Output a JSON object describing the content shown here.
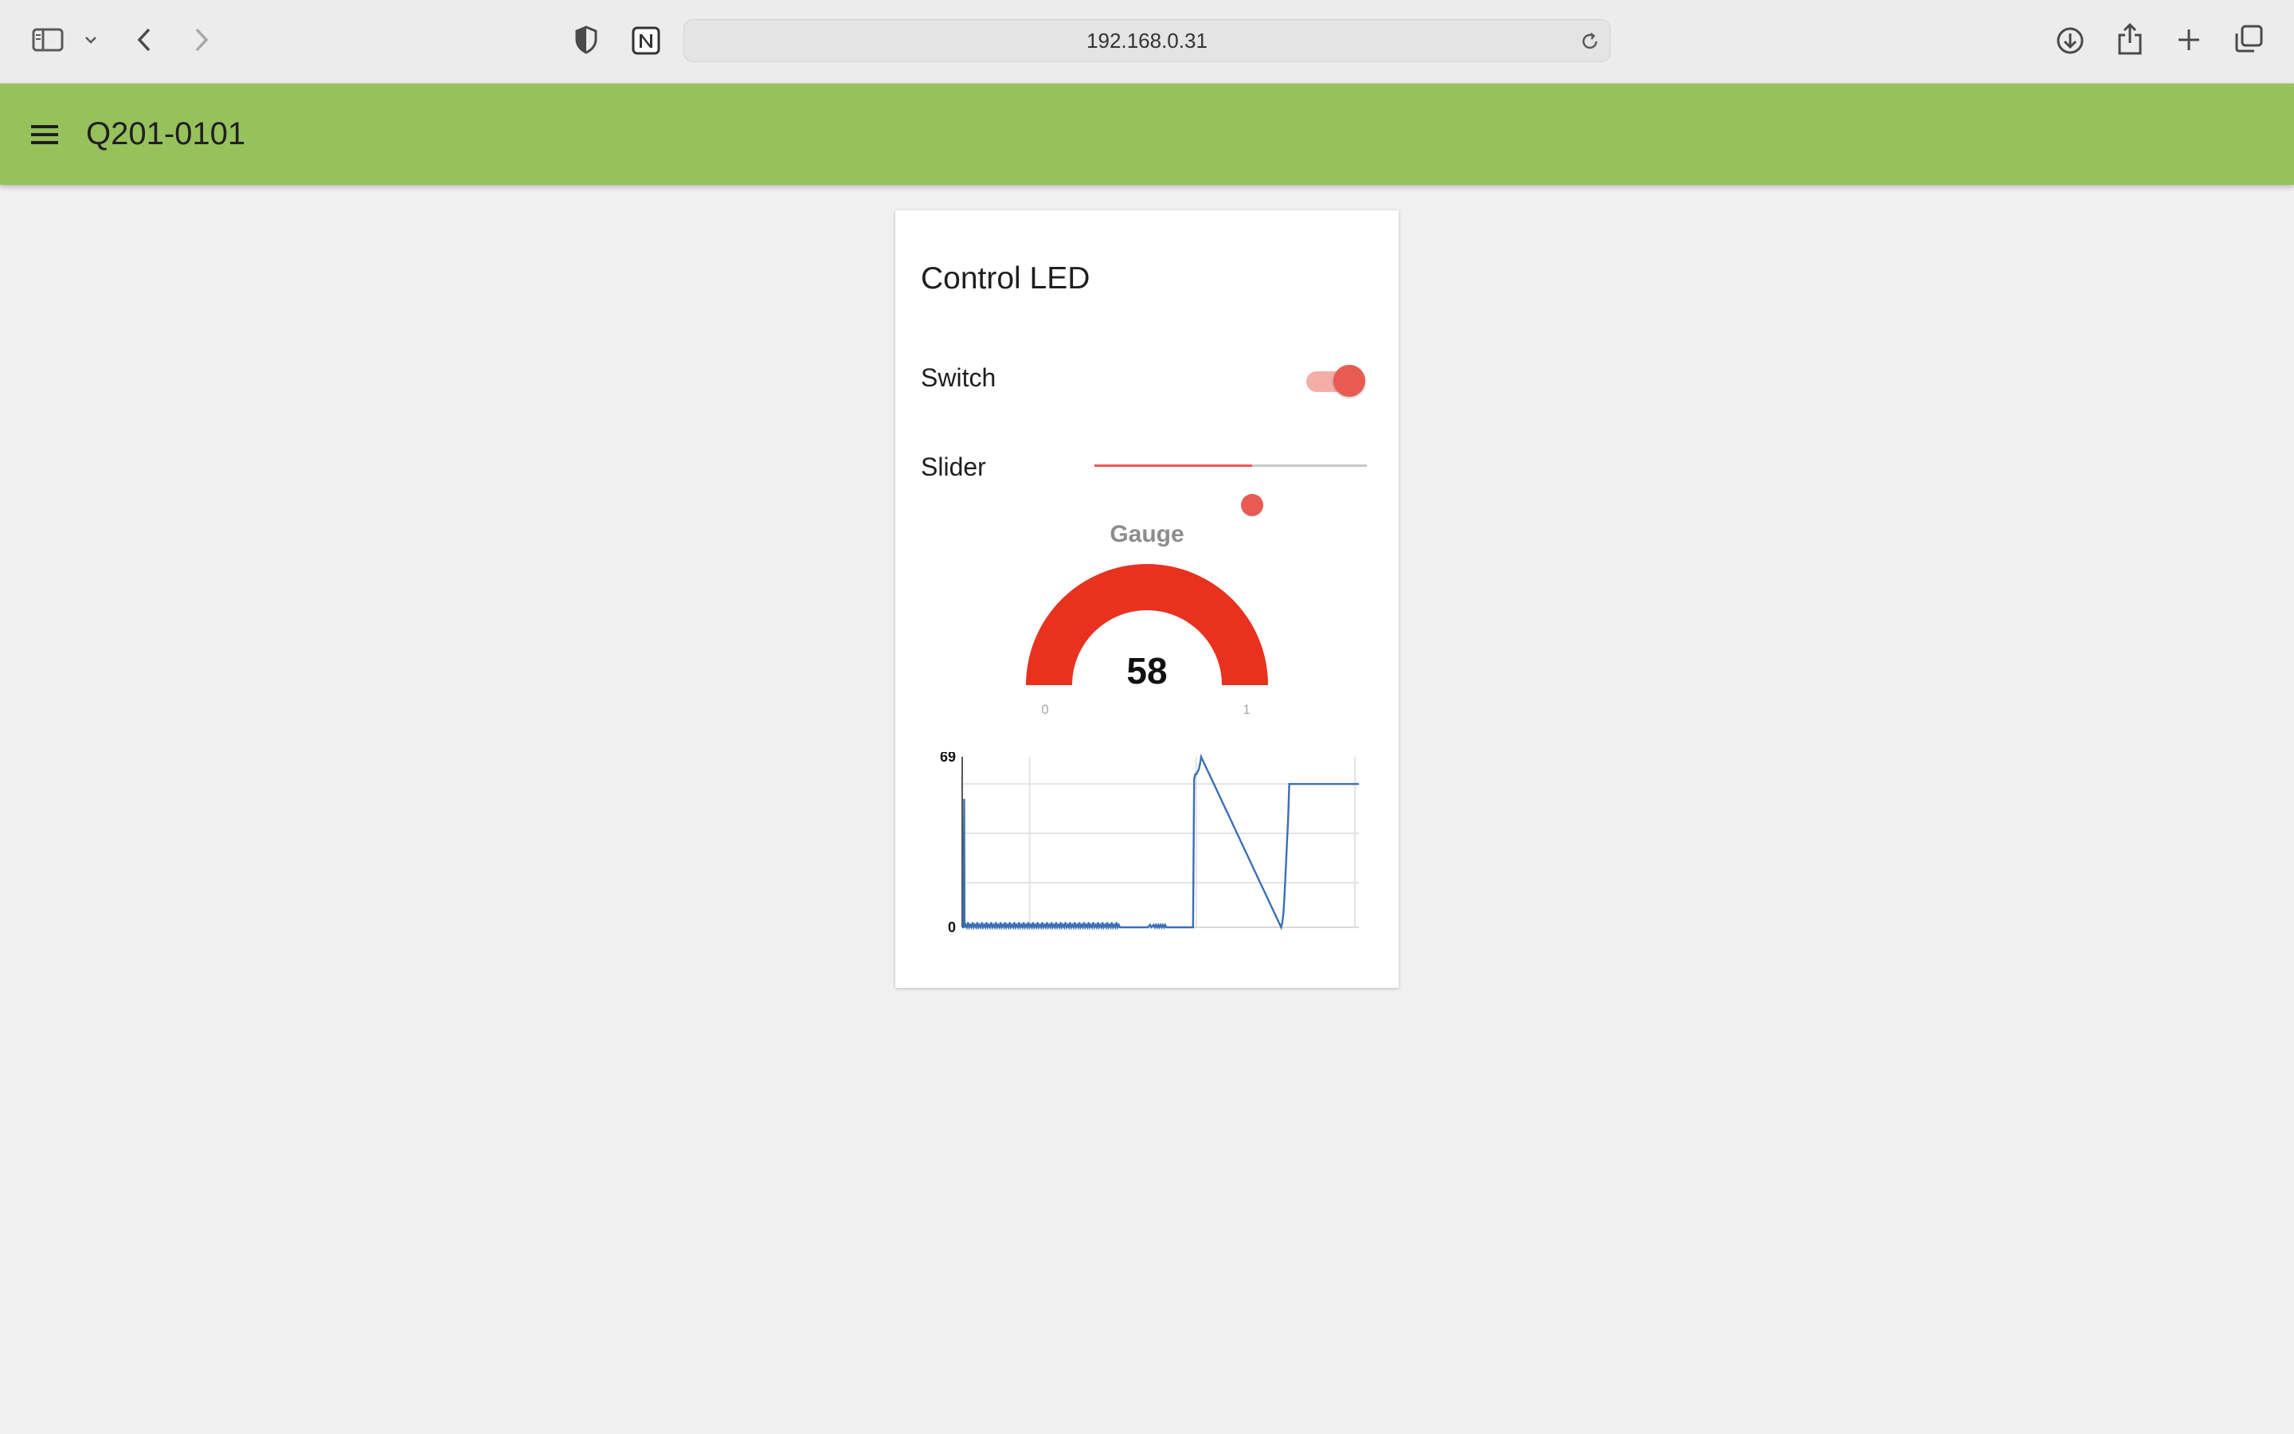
{
  "browser": {
    "url": "192.168.0.31"
  },
  "app": {
    "title": "Q201-0101"
  },
  "card": {
    "title": "Control LED",
    "switch": {
      "label": "Switch",
      "on": true
    },
    "slider": {
      "label": "Slider",
      "value_fraction": 0.58
    },
    "gauge": {
      "label": "Gauge",
      "value": "58",
      "min_label": "0",
      "max_label": "1",
      "color": "#e8321f",
      "fill_fraction": 1.0
    }
  },
  "colors": {
    "header": "#97c15b",
    "accent": "#e85b52",
    "gauge": "#e8321f",
    "chart_line": "#3a6fb5"
  },
  "chart_data": {
    "type": "line",
    "title": "",
    "xlabel": "",
    "ylabel": "",
    "ylim": [
      0,
      69
    ],
    "y_tick_labels": [
      "69",
      "0"
    ],
    "grid": true,
    "series": [
      {
        "x": [
          0,
          2,
          3.4,
          4,
          6,
          8,
          10,
          12,
          14,
          16,
          18,
          20,
          22,
          24,
          26,
          28,
          30,
          32,
          34,
          36,
          38,
          40,
          42,
          44,
          46,
          48,
          50,
          52,
          54,
          56,
          58,
          60,
          62,
          64,
          66,
          68,
          70,
          72,
          74,
          76,
          78,
          80,
          82,
          84,
          86,
          88,
          90,
          92,
          94,
          96,
          98,
          100,
          102,
          104,
          106,
          108,
          110,
          112,
          114,
          116,
          118,
          120,
          122,
          124,
          126,
          128,
          130,
          132,
          134,
          136,
          138,
          140,
          142,
          144,
          146,
          148,
          150,
          152,
          154,
          156,
          158,
          160,
          162,
          164,
          166,
          168,
          170,
          172,
          174,
          176,
          178,
          180,
          182,
          184,
          186,
          188,
          190,
          192,
          194,
          196,
          198,
          200,
          202,
          204,
          206,
          208,
          210,
          212,
          214,
          216,
          218,
          220,
          222,
          224,
          226,
          228,
          230,
          232,
          234,
          236,
          238,
          240,
          242,
          244,
          246,
          248,
          250,
          252,
          254,
          256,
          258,
          260,
          262,
          264,
          266,
          268,
          270,
          272
        ],
        "y": [
          0,
          0,
          52,
          0,
          1,
          0,
          2,
          0,
          1,
          0,
          2,
          0,
          1,
          0,
          2,
          0,
          1,
          0,
          2,
          0,
          1,
          0,
          2,
          0,
          1,
          0,
          2,
          0,
          1,
          0,
          2,
          0,
          1,
          0,
          2,
          0,
          1,
          0,
          2,
          0,
          1,
          0,
          2,
          0,
          1,
          0,
          2,
          0,
          1,
          0,
          2,
          0,
          1,
          0,
          2,
          0,
          1,
          0,
          2,
          0,
          1,
          0,
          2,
          0,
          1,
          0,
          2,
          0,
          1,
          0,
          2,
          0,
          1,
          0,
          2,
          0,
          1,
          0,
          2,
          0,
          1,
          0,
          2,
          0,
          1,
          0,
          2,
          0,
          1,
          0,
          2,
          0,
          1,
          0,
          2,
          0,
          1,
          0,
          2,
          0,
          1,
          0,
          2,
          0,
          1,
          0,
          2,
          0,
          1,
          0,
          2,
          0,
          1,
          0,
          2,
          0,
          1,
          0,
          2,
          0,
          1,
          0,
          2,
          0,
          1,
          0,
          2,
          0,
          1,
          0,
          2,
          0,
          1,
          0,
          2,
          0,
          1,
          0
        ]
      }
    ],
    "series_tail": {
      "x": [
        272,
        276,
        280,
        284,
        288,
        292,
        296,
        300,
        304,
        308,
        312,
        316,
        320,
        324,
        326,
        330,
        332,
        334,
        336,
        338,
        340,
        342,
        344,
        346,
        348,
        350,
        352,
        356,
        358,
        362,
        366,
        372,
        376,
        378,
        380,
        382,
        386,
        390,
        394,
        398,
        400,
        402,
        404,
        406,
        408,
        410,
        412,
        414,
        418,
        422,
        426,
        430,
        434,
        438,
        442,
        446,
        450,
        454,
        458,
        462,
        466,
        470,
        474,
        478,
        482,
        486,
        490,
        494,
        498,
        502,
        506,
        510,
        514,
        518,
        522,
        524,
        526,
        528,
        530,
        532,
        534,
        536,
        538,
        540,
        542,
        544,
        546,
        548,
        550,
        552,
        554,
        556,
        558,
        560,
        562,
        564,
        566,
        568,
        570,
        572,
        574,
        576,
        578,
        580,
        582,
        584,
        586,
        588,
        590,
        592,
        594,
        596,
        598,
        600,
        602,
        604,
        606,
        608,
        610,
        612,
        614,
        616,
        618,
        620,
        622,
        624,
        626,
        628,
        630,
        632,
        634,
        636,
        638,
        640,
        642,
        644,
        646,
        648,
        650,
        652,
        654,
        656,
        658,
        660,
        662,
        664,
        666,
        668,
        670,
        672,
        674,
        676,
        678,
        680,
        682,
        684
      ],
      "y": [
        0,
        0,
        0,
        0,
        0,
        0,
        0,
        0,
        0,
        0,
        0,
        0,
        0,
        1,
        0,
        1,
        0,
        1,
        0,
        1,
        0,
        1,
        0,
        1,
        0,
        1,
        0,
        0,
        0,
        0,
        0,
        0,
        0,
        0,
        0,
        0,
        0,
        0,
        0,
        0,
        60,
        62,
        62,
        63,
        64,
        66,
        69,
        68,
        66,
        64,
        62,
        60,
        58,
        56,
        54,
        52,
        50,
        48,
        46,
        44,
        42,
        40,
        38,
        36,
        34,
        32,
        30,
        28,
        26,
        24,
        22,
        20,
        18,
        16,
        14,
        13,
        12,
        11,
        10,
        9,
        8,
        7,
        6,
        5,
        4,
        3,
        2,
        1,
        0,
        2,
        6,
        14,
        24,
        34,
        44,
        58,
        58,
        58,
        58,
        58,
        58,
        58,
        58,
        58,
        58,
        58,
        58,
        58,
        58,
        58,
        58,
        58,
        58,
        58,
        58,
        58,
        58,
        58,
        58,
        58,
        58,
        58,
        58,
        58,
        58,
        58,
        58,
        58,
        58,
        58,
        58,
        58,
        58,
        58,
        58,
        58,
        58,
        58,
        58,
        58,
        58,
        58,
        58,
        58,
        58,
        58,
        58,
        58,
        58,
        58,
        58,
        58,
        58,
        58,
        58,
        58,
        58
      ]
    }
  }
}
